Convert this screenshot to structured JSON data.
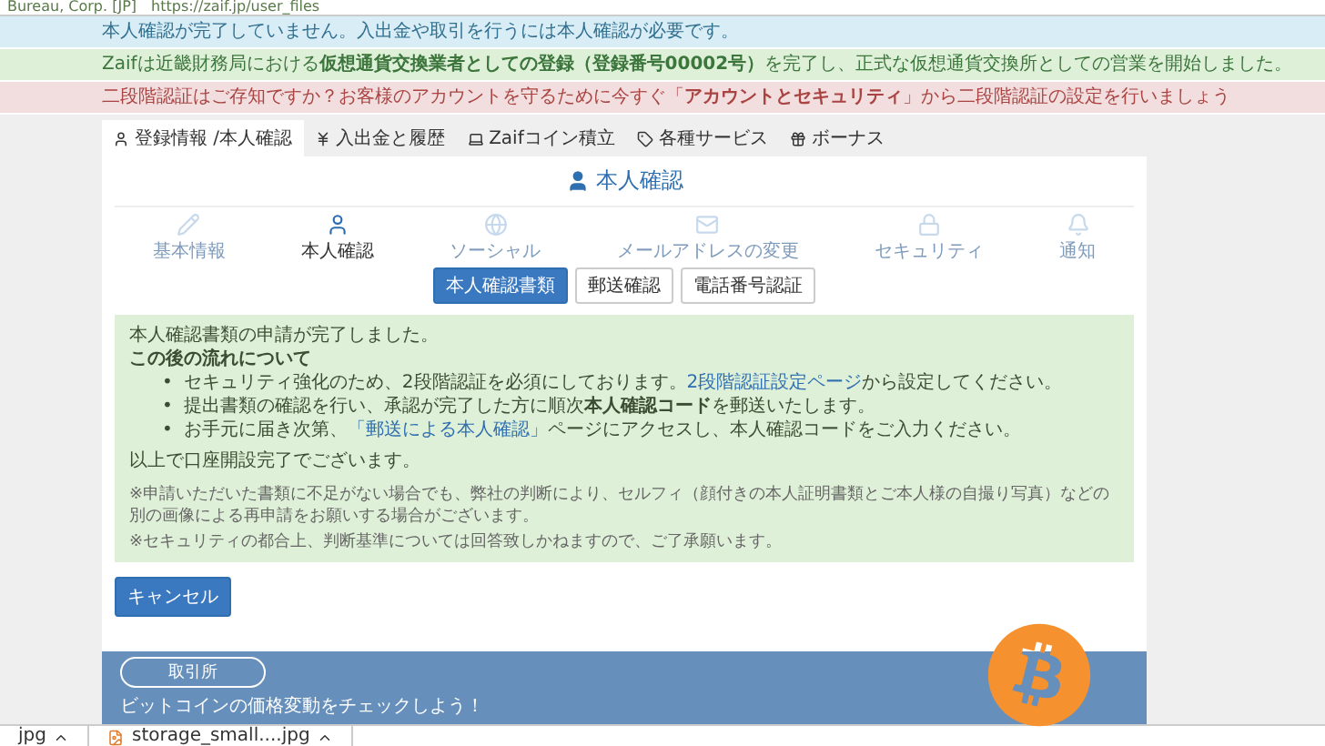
{
  "address_bar": {
    "site": "Bureau, Corp. [JP]",
    "url": "https://zaif.jp/user_files"
  },
  "banners": [
    {
      "kind": "info",
      "text": "本人確認が完了していません。入出金や取引を行うには本人確認が必要です。"
    },
    {
      "kind": "success",
      "text": "Zaifは近畿財務局における**仮想通貨交換業者としての登録（登録番号00002号）**を完了し、正式な仮想通貨交換所としての営業を開始しました。"
    },
    {
      "kind": "danger",
      "text": "二段階認証はご存知ですか？お客様のアカウントを守るために今すぐ「**アカウントとセキュリティ**」から二段階認証の設定を行いましょう"
    }
  ],
  "tabs": [
    {
      "label": "登録情報 /本人確認",
      "selected": true
    },
    {
      "label": "入出金と履歴",
      "selected": false
    },
    {
      "label": "Zaifコイン積立",
      "selected": false
    },
    {
      "label": "各種サービス",
      "selected": false
    },
    {
      "label": "ボーナス",
      "selected": false
    }
  ],
  "panel_title": "本人確認",
  "steps": [
    {
      "label": "基本情報",
      "selected": false
    },
    {
      "label": "本人確認",
      "selected": true
    },
    {
      "label": "ソーシャル",
      "selected": false
    },
    {
      "label": "メールアドレスの変更",
      "selected": false
    },
    {
      "label": "セキュリティ",
      "selected": false
    },
    {
      "label": "通知",
      "selected": false
    }
  ],
  "sub_tabs": [
    {
      "label": "本人確認書類",
      "selected": true
    },
    {
      "label": "郵送確認",
      "selected": false
    },
    {
      "label": "電話番号認証",
      "selected": false
    }
  ],
  "notice": {
    "title": "本人確認書類の申請が完了しました。",
    "subtitle": "この後の流れについて",
    "bullets": [
      {
        "marker": "•",
        "before": "セキュリティ強化のため、2段階認証を必須にしております。",
        "link": "2段階認証設定ページ",
        "after": "から設定してください。"
      },
      {
        "marker": "•",
        "before": "提出書類の確認を行い、承認が完了した方に順次**本人確認コード**を郵送いたします。"
      },
      {
        "marker": "•",
        "before": "お手元に届き次第、",
        "link": "「郵送による本人確認」",
        "after": "ページにアクセスし、本人確認コードをご入力ください。"
      }
    ],
    "completion": "以上で口座開設完了でございます。",
    "notes": [
      "※申請いただいた書類に不足がない場合でも、弊社の判断により、セルフィ（顔付きの本人証明書類とご本人様の自撮り写真）などの別の画像による再申請をお願いする場合がございます。",
      "※セキュリティの都合上、判断基準については回答致しかねますので、ご了承願います。"
    ]
  },
  "cancel_button": "キャンセル",
  "footer": {
    "button": "取引所",
    "text": "ビットコインの価格変動をチェックしよう！"
  },
  "downloads": [
    "jpg",
    "storage_small....jpg"
  ]
}
